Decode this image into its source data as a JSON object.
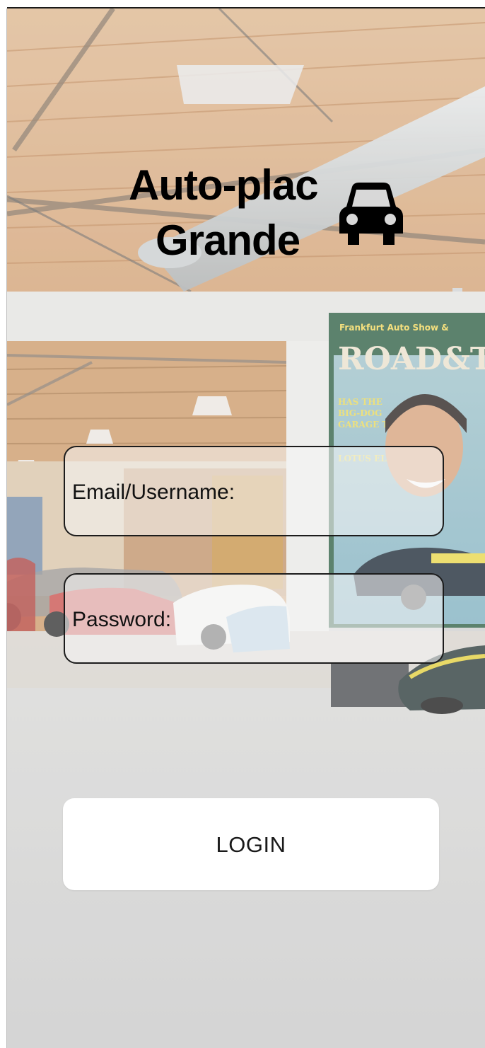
{
  "app": {
    "title_line1": "Auto-plac",
    "title_line2": "Grande",
    "logo_icon": "car-icon"
  },
  "form": {
    "email_label": "Email/Username:",
    "email_value": "",
    "password_label": "Password:",
    "password_value": ""
  },
  "login_button": {
    "label": "LOGIN"
  },
  "colors": {
    "title": "#000000",
    "field_border": "#1c1c1c",
    "button_bg": "#ffffff",
    "button_text": "#1a1a1a"
  }
}
